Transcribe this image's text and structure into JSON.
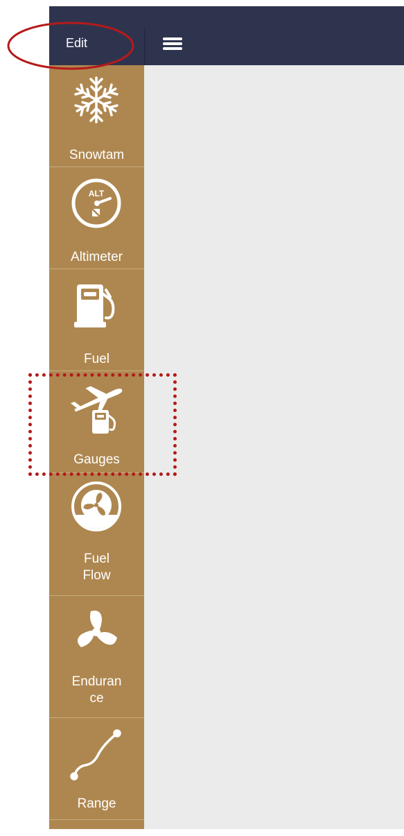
{
  "topbar": {
    "edit_label": "Edit",
    "menu_icon": "hamburger-menu-icon",
    "background_color": "#2f344e"
  },
  "sidebar": {
    "background_color": "#ae8750",
    "items": [
      {
        "label": "Snowtam",
        "icon": "snowflake-icon"
      },
      {
        "label": "Altimeter",
        "icon": "altimeter-icon"
      },
      {
        "label": "Fuel",
        "icon": "fuel-pump-icon"
      },
      {
        "label": "Gauges",
        "icon": "plane-fuel-icon"
      },
      {
        "label": "Fuel\nFlow",
        "icon": "fan-gauge-icon"
      },
      {
        "label": "Enduran\nce",
        "icon": "propeller-icon"
      },
      {
        "label": "Range",
        "icon": "range-graph-icon"
      }
    ]
  },
  "annotations": {
    "highlight_color": "#b51a1a"
  }
}
